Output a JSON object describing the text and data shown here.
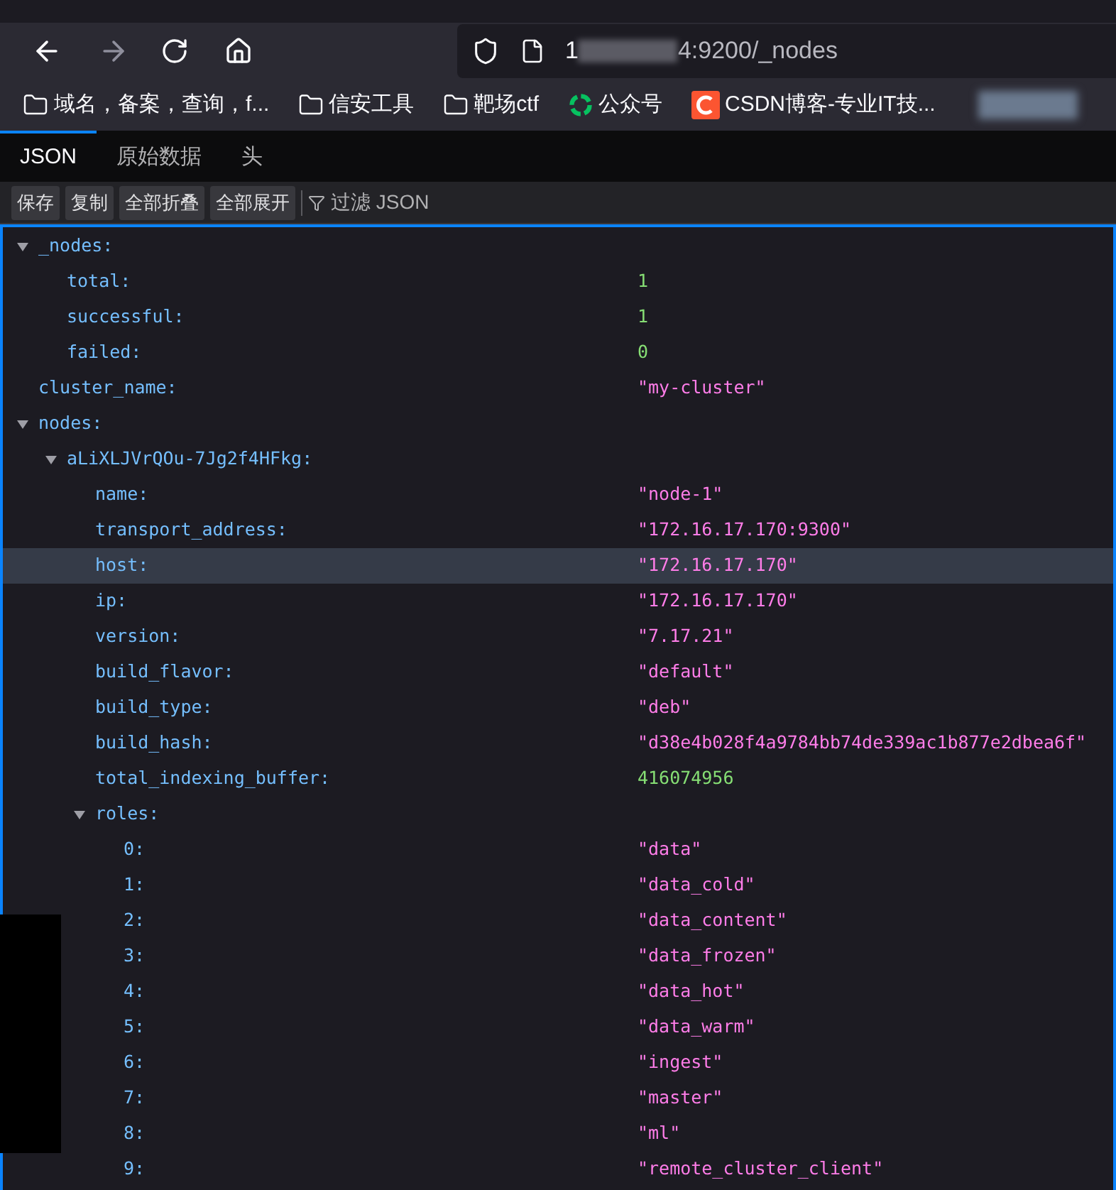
{
  "browser": {
    "url_prefix": "1",
    "url_suffix": "4:9200/_nodes",
    "bookmarks": [
      {
        "kind": "folder",
        "label": "域名，备案，查询，f..."
      },
      {
        "kind": "folder",
        "label": "信安工具"
      },
      {
        "kind": "folder",
        "label": "靶场ctf"
      },
      {
        "kind": "wechat",
        "label": "公众号"
      },
      {
        "kind": "csdn",
        "label": "CSDN博客-专业IT技..."
      }
    ]
  },
  "viewer_tabs": [
    {
      "label": "JSON",
      "selected": true
    },
    {
      "label": "原始数据",
      "selected": false
    },
    {
      "label": "头",
      "selected": false
    }
  ],
  "toolbar": {
    "buttons": [
      "保存",
      "复制",
      "全部折叠",
      "全部展开"
    ],
    "filter_placeholder": "过滤 JSON"
  },
  "tree": [
    {
      "key": "_nodes:",
      "expanded": true,
      "selected": false,
      "children": [
        {
          "key": "total:",
          "value": "1",
          "kind": "number",
          "selected": false
        },
        {
          "key": "successful:",
          "value": "1",
          "kind": "number",
          "selected": false
        },
        {
          "key": "failed:",
          "value": "0",
          "kind": "number",
          "selected": false
        }
      ]
    },
    {
      "key": "cluster_name:",
      "value": "\"my-cluster\"",
      "kind": "string",
      "selected": false
    },
    {
      "key": "nodes:",
      "expanded": true,
      "selected": false,
      "children": [
        {
          "key": "aLiXLJVrQOu-7Jg2f4HFkg:",
          "expanded": true,
          "selected": false,
          "children": [
            {
              "key": "name:",
              "value": "\"node-1\"",
              "kind": "string",
              "selected": false
            },
            {
              "key": "transport_address:",
              "value": "\"172.16.17.170:9300\"",
              "kind": "string",
              "selected": false
            },
            {
              "key": "host:",
              "value": "\"172.16.17.170\"",
              "kind": "string",
              "selected": true
            },
            {
              "key": "ip:",
              "value": "\"172.16.17.170\"",
              "kind": "string",
              "selected": false
            },
            {
              "key": "version:",
              "value": "\"7.17.21\"",
              "kind": "string",
              "selected": false
            },
            {
              "key": "build_flavor:",
              "value": "\"default\"",
              "kind": "string",
              "selected": false
            },
            {
              "key": "build_type:",
              "value": "\"deb\"",
              "kind": "string",
              "selected": false
            },
            {
              "key": "build_hash:",
              "value": "\"d38e4b028f4a9784bb74de339ac1b877e2dbea6f\"",
              "kind": "string",
              "selected": false
            },
            {
              "key": "total_indexing_buffer:",
              "value": "416074956",
              "kind": "number",
              "selected": false
            },
            {
              "key": "roles:",
              "expanded": true,
              "selected": false,
              "children": [
                {
                  "key": "0:",
                  "value": "\"data\"",
                  "kind": "string",
                  "selected": false
                },
                {
                  "key": "1:",
                  "value": "\"data_cold\"",
                  "kind": "string",
                  "selected": false
                },
                {
                  "key": "2:",
                  "value": "\"data_content\"",
                  "kind": "string",
                  "selected": false
                },
                {
                  "key": "3:",
                  "value": "\"data_frozen\"",
                  "kind": "string",
                  "selected": false
                },
                {
                  "key": "4:",
                  "value": "\"data_hot\"",
                  "kind": "string",
                  "selected": false
                },
                {
                  "key": "5:",
                  "value": "\"data_warm\"",
                  "kind": "string",
                  "selected": false
                },
                {
                  "key": "6:",
                  "value": "\"ingest\"",
                  "kind": "string",
                  "selected": false
                },
                {
                  "key": "7:",
                  "value": "\"master\"",
                  "kind": "string",
                  "selected": false
                },
                {
                  "key": "8:",
                  "value": "\"ml\"",
                  "kind": "string",
                  "selected": false
                },
                {
                  "key": "9:",
                  "value": "\"remote_cluster_client\"",
                  "kind": "string",
                  "selected": false
                }
              ]
            }
          ]
        }
      ]
    }
  ]
}
